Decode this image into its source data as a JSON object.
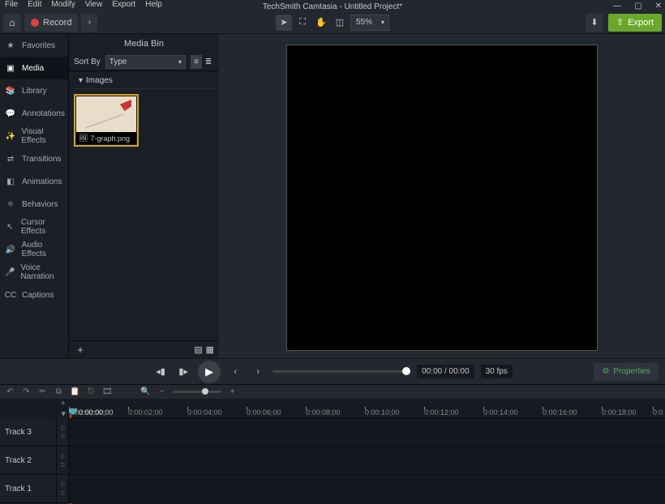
{
  "app": {
    "title": "TechSmith Camtasia - Untitled Project*"
  },
  "menubar": [
    "File",
    "Edit",
    "Modify",
    "View",
    "Export",
    "Help"
  ],
  "record_label": "Record",
  "export_label": "Export",
  "canvas_zoom": "55%",
  "sidebar": {
    "items": [
      {
        "label": "Favorites",
        "icon": "★"
      },
      {
        "label": "Media",
        "icon": "▣"
      },
      {
        "label": "Library",
        "icon": "📚"
      },
      {
        "label": "Annotations",
        "icon": "💬"
      },
      {
        "label": "Visual Effects",
        "icon": "✨"
      },
      {
        "label": "Transitions",
        "icon": "⇄"
      },
      {
        "label": "Animations",
        "icon": "◧"
      },
      {
        "label": "Behaviors",
        "icon": "⚛"
      },
      {
        "label": "Cursor Effects",
        "icon": "↖"
      },
      {
        "label": "Audio Effects",
        "icon": "🔊"
      },
      {
        "label": "Voice Narration",
        "icon": "🎤"
      },
      {
        "label": "Captions",
        "icon": "CC"
      }
    ],
    "active_index": 1
  },
  "mediabin": {
    "title": "Media Bin",
    "sort_label": "Sort By",
    "sort_value": "Type",
    "group_label": "Images",
    "items": [
      {
        "name": "7-graph.png",
        "icon": "🖼"
      }
    ]
  },
  "playback": {
    "time": "00:00 / 00:00",
    "fps": "30 fps",
    "properties_label": "Properties"
  },
  "timeline": {
    "playhead_time": "0:00:00;00",
    "ticks": [
      "0:00:00;00",
      "0:00:02;00",
      "0:00:04;00",
      "0:00:06;00",
      "0:00:08;00",
      "0:00:10;00",
      "0:00:12;00",
      "0:00:14;00",
      "0:00:16;00",
      "0:00:18;00",
      "0:0"
    ],
    "tracks": [
      "Track 3",
      "Track 2",
      "Track 1"
    ]
  }
}
